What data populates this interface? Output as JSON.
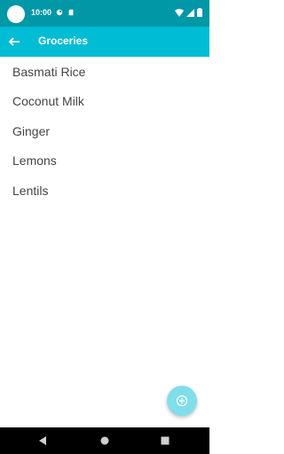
{
  "status_bar": {
    "time": "10:00",
    "icons": [
      "avatar",
      "sync-icon",
      "sd-card-icon",
      "wifi-icon",
      "signal-icon",
      "battery-icon"
    ]
  },
  "app_bar": {
    "title": "Groceries",
    "back_icon": "arrow-back-icon"
  },
  "list": {
    "items": [
      {
        "label": "Basmati Rice"
      },
      {
        "label": "Coconut Milk"
      },
      {
        "label": "Ginger"
      },
      {
        "label": "Lemons"
      },
      {
        "label": "Lentils"
      }
    ]
  },
  "fab": {
    "icon": "add-circle-icon"
  },
  "nav": {
    "icons": [
      "back-triangle-icon",
      "home-circle-icon",
      "recents-square-icon"
    ]
  },
  "colors": {
    "status_bar": "#0097a7",
    "app_bar": "#00bcd4",
    "fab": "#80deea",
    "list_text": "#444444",
    "nav_bar": "#000000"
  }
}
